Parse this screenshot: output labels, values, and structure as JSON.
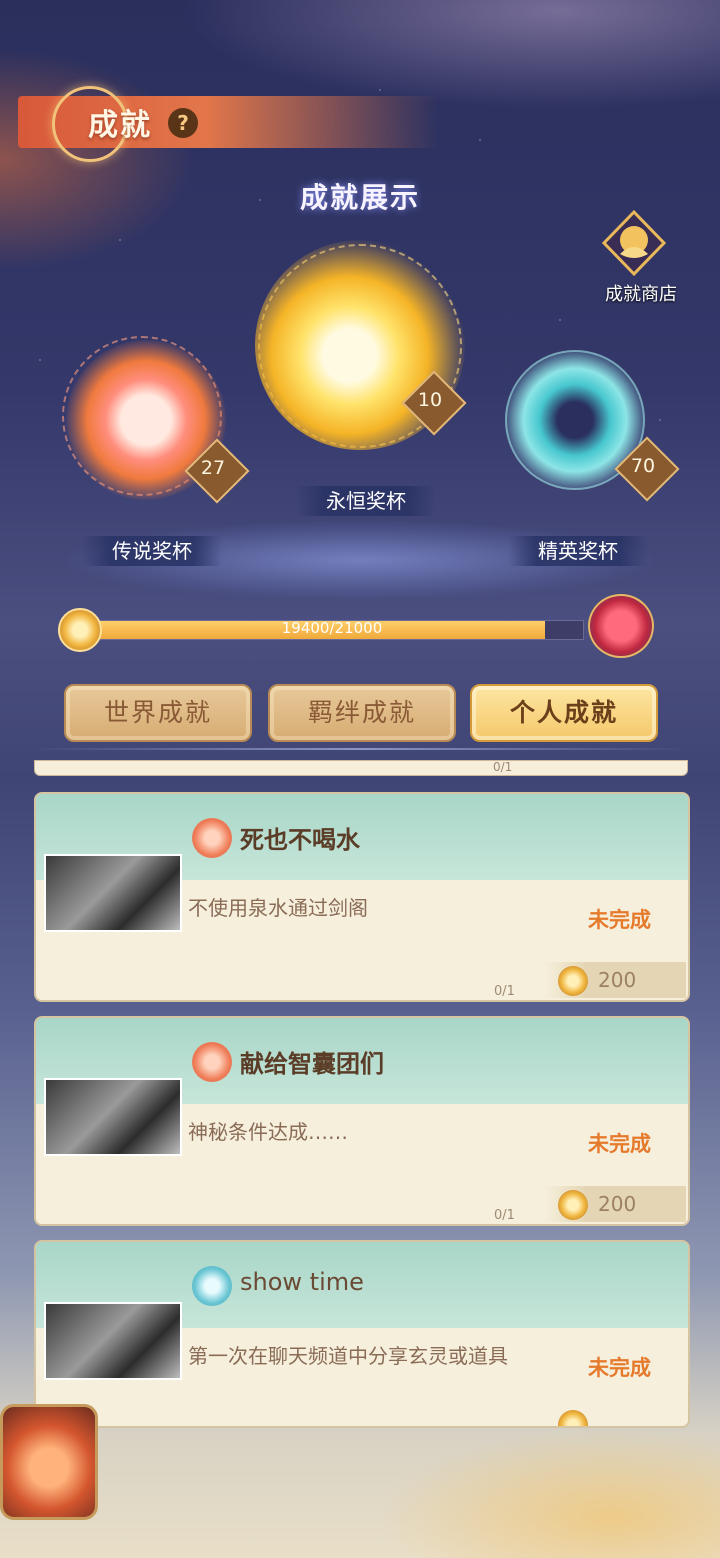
{
  "header": {
    "title": "成就",
    "help": "?"
  },
  "showcase": {
    "title": "成就展示"
  },
  "shop": {
    "label": "成就商店",
    "icon": "lotus-dragon-icon"
  },
  "trophies": [
    {
      "label": "传说奖杯",
      "count": "27"
    },
    {
      "label": "永恒奖杯",
      "count": "10"
    },
    {
      "label": "精英奖杯",
      "count": "70"
    }
  ],
  "progress": {
    "text": "19400/21000",
    "current": 19400,
    "total": 21000,
    "fraction": 0.924
  },
  "tabs": [
    {
      "label": "世界成就",
      "active": false
    },
    {
      "label": "羁绊成就",
      "active": false
    },
    {
      "label": "个人成就",
      "active": true
    }
  ],
  "achievements": [
    {
      "title": "死也不喝水",
      "desc": "不使用泉水通过剑阁",
      "status": "未完成",
      "progress": "0/1",
      "reward": "200",
      "emblem": "red-phoenix-icon"
    },
    {
      "title": "献给智囊团们",
      "desc": "神秘条件达成……",
      "status": "未完成",
      "progress": "0/1",
      "reward": "200",
      "emblem": "red-phoenix-icon"
    },
    {
      "title": "show time",
      "desc": "第一次在聊天频道中分享玄灵或道具",
      "status": "未完成",
      "progress": "",
      "reward": "",
      "emblem": "teal-fish-icon"
    }
  ],
  "peek": {
    "progress": "0/1"
  },
  "colors": {
    "accent": "#f0a93a",
    "status": "#e67a2c",
    "title_bar": "#d8593a"
  }
}
